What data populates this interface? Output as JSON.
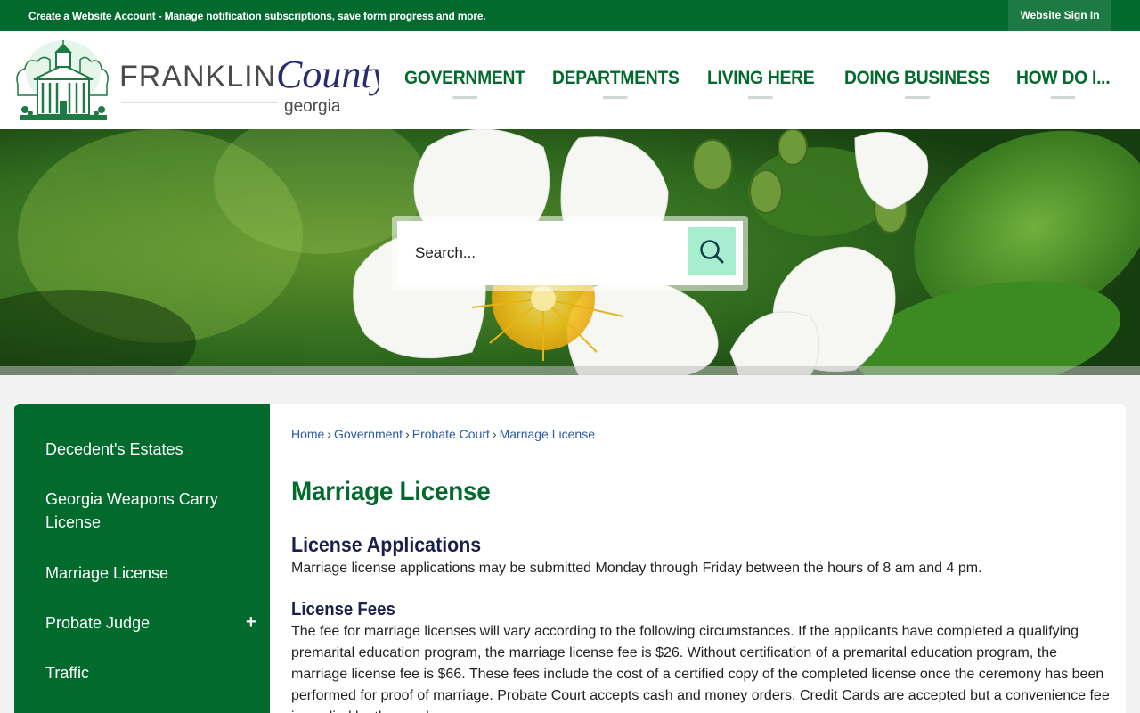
{
  "topbar": {
    "create_account": "Create a Website Account",
    "message": " - Manage notification subscriptions, save form progress and more.",
    "sign_in": "Website Sign In"
  },
  "logo": {
    "franklin": "FRANKLIN",
    "county": "County",
    "georgia": "georgia"
  },
  "nav": {
    "items": [
      "GOVERNMENT",
      "DEPARTMENTS",
      "LIVING HERE",
      "DOING BUSINESS",
      "HOW DO I..."
    ]
  },
  "search": {
    "placeholder": "Search..."
  },
  "sidebar": {
    "items": [
      "Decedent's Estates",
      "Georgia Weapons Carry License",
      "Marriage License",
      "Probate Judge",
      "Traffic"
    ],
    "expand_symbol": "+"
  },
  "breadcrumb": {
    "items": [
      "Home",
      "Government",
      "Probate Court",
      "Marriage License"
    ],
    "separator": "›"
  },
  "content": {
    "title": "Marriage License",
    "applications_heading": "License Applications",
    "applications_text": "Marriage license applications may be submitted Monday through Friday between the hours of 8 am and 4 pm.",
    "fees_heading": "License Fees",
    "fees_text": "The fee for marriage licenses will vary according to the following circumstances. If the applicants have completed a qualifying premarital education program, the marriage license fee is $26. Without certification of a premarital education program, the marriage license fee is $66. These fees include the cost of a certified copy of the completed license once the ceremony has been performed for proof of marriage. Probate Court accepts cash and money orders. Credit Cards are accepted but a convenience fee is applied by the vendor."
  },
  "colors": {
    "brand_green": "#036a2e",
    "search_button": "#a7eed1",
    "link_blue": "#2a5aa8",
    "heading_navy": "#1b1f4a"
  }
}
